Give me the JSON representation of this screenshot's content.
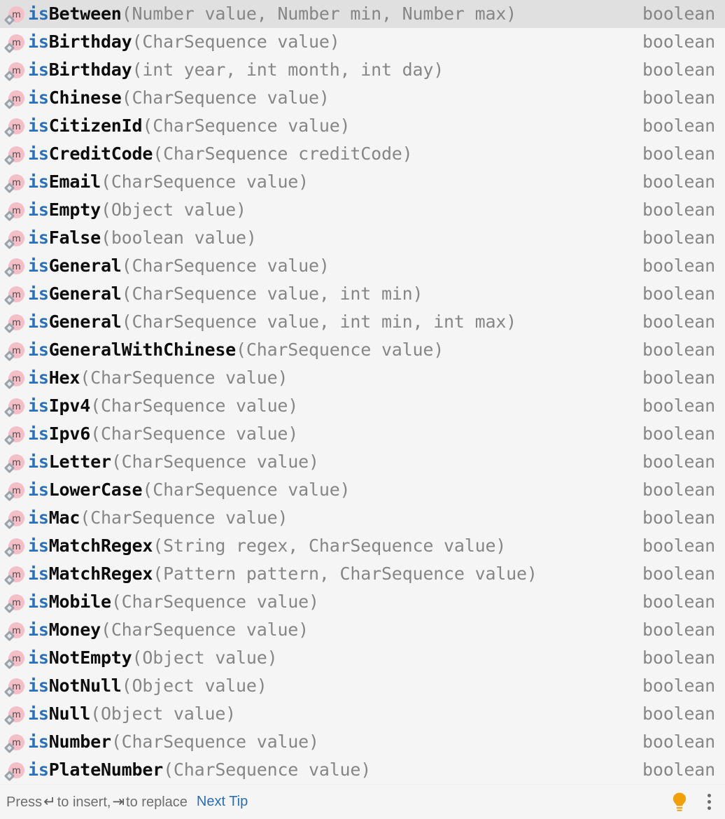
{
  "popup": {
    "kind": "code-completion-popup",
    "background_color": "#F5F5F6",
    "selected_row_color": "#E0E0E0",
    "accent_link_color": "#2A6DB5",
    "prefix_match_color": "#2A70B8",
    "param_text_color": "#868686",
    "method_icon_color": "#F5BFC8",
    "bulb_color": "#EFA00B"
  },
  "icons": {
    "method": "m",
    "bulb": "lightbulb-icon",
    "more": "more-options-icon"
  },
  "items": [
    {
      "icon": "method-icon",
      "prefix": "is",
      "name": "Between",
      "params": "(Number value, Number min, Number max)",
      "return": "boolean",
      "selected": true
    },
    {
      "icon": "method-icon",
      "prefix": "is",
      "name": "Birthday",
      "params": "(CharSequence value)",
      "return": "boolean",
      "selected": false
    },
    {
      "icon": "method-icon",
      "prefix": "is",
      "name": "Birthday",
      "params": "(int year, int month, int day)",
      "return": "boolean",
      "selected": false
    },
    {
      "icon": "method-icon",
      "prefix": "is",
      "name": "Chinese",
      "params": "(CharSequence value)",
      "return": "boolean",
      "selected": false
    },
    {
      "icon": "method-icon",
      "prefix": "is",
      "name": "CitizenId",
      "params": "(CharSequence value)",
      "return": "boolean",
      "selected": false
    },
    {
      "icon": "method-icon",
      "prefix": "is",
      "name": "CreditCode",
      "params": "(CharSequence creditCode)",
      "return": "boolean",
      "selected": false
    },
    {
      "icon": "method-icon",
      "prefix": "is",
      "name": "Email",
      "params": "(CharSequence value)",
      "return": "boolean",
      "selected": false
    },
    {
      "icon": "method-icon",
      "prefix": "is",
      "name": "Empty",
      "params": "(Object value)",
      "return": "boolean",
      "selected": false
    },
    {
      "icon": "method-icon",
      "prefix": "is",
      "name": "False",
      "params": "(boolean value)",
      "return": "boolean",
      "selected": false
    },
    {
      "icon": "method-icon",
      "prefix": "is",
      "name": "General",
      "params": "(CharSequence value)",
      "return": "boolean",
      "selected": false
    },
    {
      "icon": "method-icon",
      "prefix": "is",
      "name": "General",
      "params": "(CharSequence value, int min)",
      "return": "boolean",
      "selected": false
    },
    {
      "icon": "method-icon",
      "prefix": "is",
      "name": "General",
      "params": "(CharSequence value, int min, int max)",
      "return": "boolean",
      "selected": false
    },
    {
      "icon": "method-icon",
      "prefix": "is",
      "name": "GeneralWithChinese",
      "params": "(CharSequence value)",
      "return": "boolean",
      "selected": false
    },
    {
      "icon": "method-icon",
      "prefix": "is",
      "name": "Hex",
      "params": "(CharSequence value)",
      "return": "boolean",
      "selected": false
    },
    {
      "icon": "method-icon",
      "prefix": "is",
      "name": "Ipv4",
      "params": "(CharSequence value)",
      "return": "boolean",
      "selected": false
    },
    {
      "icon": "method-icon",
      "prefix": "is",
      "name": "Ipv6",
      "params": "(CharSequence value)",
      "return": "boolean",
      "selected": false
    },
    {
      "icon": "method-icon",
      "prefix": "is",
      "name": "Letter",
      "params": "(CharSequence value)",
      "return": "boolean",
      "selected": false
    },
    {
      "icon": "method-icon",
      "prefix": "is",
      "name": "LowerCase",
      "params": "(CharSequence value)",
      "return": "boolean",
      "selected": false
    },
    {
      "icon": "method-icon",
      "prefix": "is",
      "name": "Mac",
      "params": "(CharSequence value)",
      "return": "boolean",
      "selected": false
    },
    {
      "icon": "method-icon",
      "prefix": "is",
      "name": "MatchRegex",
      "params": "(String regex, CharSequence value)",
      "return": "boolean",
      "selected": false
    },
    {
      "icon": "method-icon",
      "prefix": "is",
      "name": "MatchRegex",
      "params": "(Pattern pattern, CharSequence value)",
      "return": "boolean",
      "selected": false
    },
    {
      "icon": "method-icon",
      "prefix": "is",
      "name": "Mobile",
      "params": "(CharSequence value)",
      "return": "boolean",
      "selected": false
    },
    {
      "icon": "method-icon",
      "prefix": "is",
      "name": "Money",
      "params": "(CharSequence value)",
      "return": "boolean",
      "selected": false
    },
    {
      "icon": "method-icon",
      "prefix": "is",
      "name": "NotEmpty",
      "params": "(Object value)",
      "return": "boolean",
      "selected": false
    },
    {
      "icon": "method-icon",
      "prefix": "is",
      "name": "NotNull",
      "params": "(Object value)",
      "return": "boolean",
      "selected": false
    },
    {
      "icon": "method-icon",
      "prefix": "is",
      "name": "Null",
      "params": "(Object value)",
      "return": "boolean",
      "selected": false
    },
    {
      "icon": "method-icon",
      "prefix": "is",
      "name": "Number",
      "params": "(CharSequence value)",
      "return": "boolean",
      "selected": false
    },
    {
      "icon": "method-icon",
      "prefix": "is",
      "name": "PlateNumber",
      "params": "(CharSequence value)",
      "return": "boolean",
      "selected": false
    }
  ],
  "footer": {
    "hint_lead": "Press",
    "key_insert": "↵",
    "hint_mid": "to insert,",
    "key_replace": "⇥",
    "hint_tail": "to replace",
    "next_tip_label": "Next Tip"
  }
}
